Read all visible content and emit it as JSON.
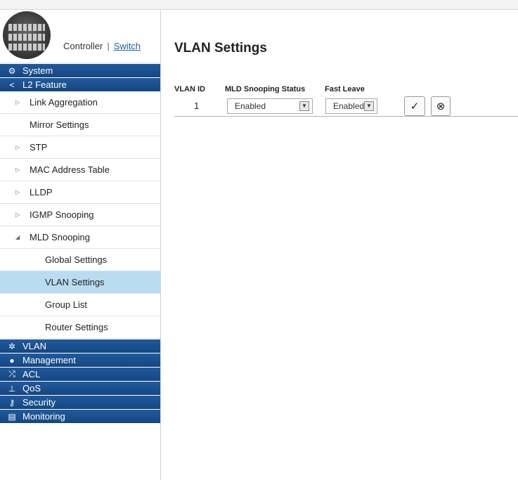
{
  "header": {
    "controller_label": "Controller",
    "separator": "|",
    "switch_label": "Switch"
  },
  "sidebar": {
    "sections": [
      {
        "label": "System",
        "icon": "gear-icon"
      },
      {
        "label": "L2 Feature",
        "icon": "share-icon"
      },
      {
        "label": "VLAN",
        "icon": "vlan-icon"
      },
      {
        "label": "Management",
        "icon": "user-icon"
      },
      {
        "label": "ACL",
        "icon": "shuffle-icon"
      },
      {
        "label": "QoS",
        "icon": "network-icon"
      },
      {
        "label": "Security",
        "icon": "key-icon"
      },
      {
        "label": "Monitoring",
        "icon": "monitor-icon"
      }
    ],
    "l2_items": [
      {
        "label": "Link Aggregation"
      },
      {
        "label": "Mirror Settings"
      },
      {
        "label": "STP"
      },
      {
        "label": "MAC Address Table"
      },
      {
        "label": "LLDP"
      },
      {
        "label": "IGMP Snooping"
      },
      {
        "label": "MLD Snooping"
      }
    ],
    "mld_items": [
      {
        "label": "Global Settings"
      },
      {
        "label": "VLAN Settings"
      },
      {
        "label": "Group List"
      },
      {
        "label": "Router Settings"
      }
    ]
  },
  "main": {
    "title": "VLAN Settings",
    "columns": [
      "VLAN ID",
      "MLD Snooping Status",
      "Fast Leave"
    ],
    "rows": [
      {
        "vlan_id": "1",
        "mld_status": "Enabled",
        "fast_leave": "Enabled"
      }
    ]
  },
  "colors": {
    "section_bar": "#1f5aa0",
    "active_item": "#b9dcf0",
    "link": "#1a5fa8"
  }
}
